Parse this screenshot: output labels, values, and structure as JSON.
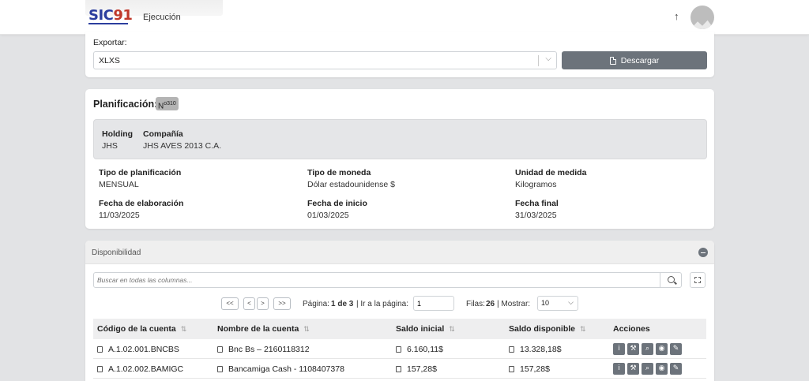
{
  "header": {
    "logo_text_a": "SIC",
    "logo_text_b": "91",
    "module": "Ejecución",
    "up_icon": "arrow-up-icon",
    "avatar_icon": "user-avatar"
  },
  "export": {
    "label": "Exportar:",
    "format_value": "XLXS",
    "download_label": "Descargar"
  },
  "planificacion": {
    "title": "Planificación:",
    "badge_prefix": "N",
    "badge_number": "310",
    "holding_label": "Holding",
    "holding_value": "JHS",
    "compania_label": "Compañía",
    "compania_value": "JHS AVES 2013 C.A.",
    "fields": [
      {
        "label": "Tipo de planificación",
        "value": "MENSUAL"
      },
      {
        "label": "Tipo de moneda",
        "value": "Dólar estadounidense $"
      },
      {
        "label": "Unidad de medida",
        "value": "Kilogramos"
      },
      {
        "label": "Fecha de elaboración",
        "value": "11/03/2025"
      },
      {
        "label": "Fecha de inicio",
        "value": "01/03/2025"
      },
      {
        "label": "Fecha final",
        "value": "31/03/2025"
      }
    ]
  },
  "disponibilidad": {
    "title": "Disponibilidad",
    "search_placeholder": "Buscar en todas las columnas...",
    "pagination": {
      "first": "<<",
      "prev": "<",
      "next": ">",
      "last": ">>",
      "page_label": "Página:",
      "page_value": "1 de 3",
      "goto_label": "| Ir a la página:",
      "goto_value": "1",
      "rows_label": "Filas:",
      "rows_value": "26",
      "show_label": "| Mostrar:",
      "show_value": "10"
    },
    "columns": [
      "Código de la cuenta",
      "Nombre de la cuenta",
      "Saldo inicial",
      "Saldo disponible",
      "Acciones"
    ],
    "rows": [
      {
        "codigo": "A.1.02.001.BNCBS",
        "nombre": "Bnc Bs – 2160118312",
        "saldo_inicial": "6.160,11$",
        "saldo_disponible": "13.328,18$"
      },
      {
        "codigo": "A.1.02.002.BAMIGC",
        "nombre": "Bancamiga Cash - 1108407378",
        "saldo_inicial": "157,28$",
        "saldo_disponible": "157,28$"
      }
    ],
    "actions": [
      "info-icon",
      "tools-icon",
      "document-search-icon",
      "eye-icon",
      "edit-icon"
    ]
  }
}
